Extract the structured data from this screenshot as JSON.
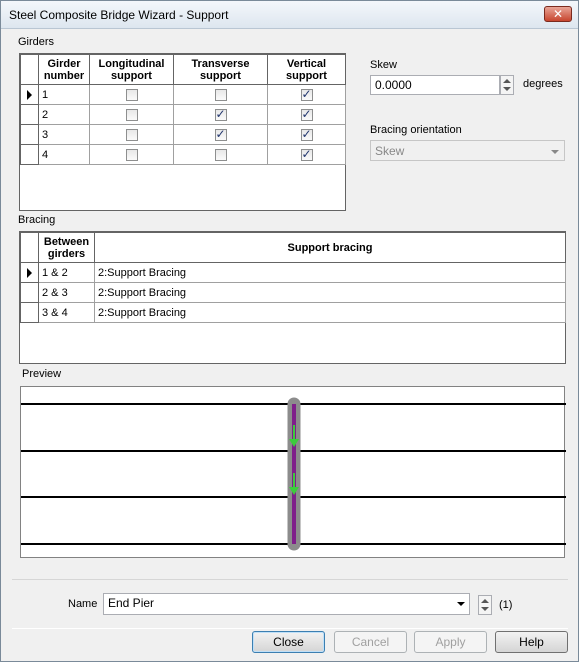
{
  "window": {
    "title": "Steel Composite Bridge Wizard - Support",
    "close_label": "✕"
  },
  "girders": {
    "section_label": "Girders",
    "headers": [
      "Girder number",
      "Longitudinal support",
      "Transverse support",
      "Vertical support"
    ],
    "rows": [
      {
        "number": "1",
        "longitudinal": false,
        "transverse": false,
        "vertical": true,
        "selected": true
      },
      {
        "number": "2",
        "longitudinal": false,
        "transverse": true,
        "vertical": true,
        "selected": false
      },
      {
        "number": "3",
        "longitudinal": false,
        "transverse": true,
        "vertical": true,
        "selected": false
      },
      {
        "number": "4",
        "longitudinal": false,
        "transverse": false,
        "vertical": true,
        "selected": false
      }
    ]
  },
  "skew": {
    "label": "Skew",
    "value": "0.0000",
    "unit": "degrees"
  },
  "bracing_orientation": {
    "label": "Bracing orientation",
    "value": "Skew"
  },
  "bracing": {
    "section_label": "Bracing",
    "headers": [
      "Between girders",
      "Support bracing"
    ],
    "rows": [
      {
        "between": "1 & 2",
        "support": "2:Support Bracing",
        "selected": true
      },
      {
        "between": "2 & 3",
        "support": "2:Support Bracing",
        "selected": false
      },
      {
        "between": "3 & 4",
        "support": "2:Support Bracing",
        "selected": false
      }
    ]
  },
  "preview": {
    "label": "Preview"
  },
  "name": {
    "label": "Name",
    "value": "End Pier",
    "index": "(1)"
  },
  "buttons": {
    "close": "Close",
    "cancel": "Cancel",
    "apply": "Apply",
    "help": "Help"
  },
  "colors": {
    "support_line": "#7f1f8a",
    "support_shadow": "#8c8c8c",
    "arrow": "#3ccc3c",
    "girder_line": "#000000"
  }
}
